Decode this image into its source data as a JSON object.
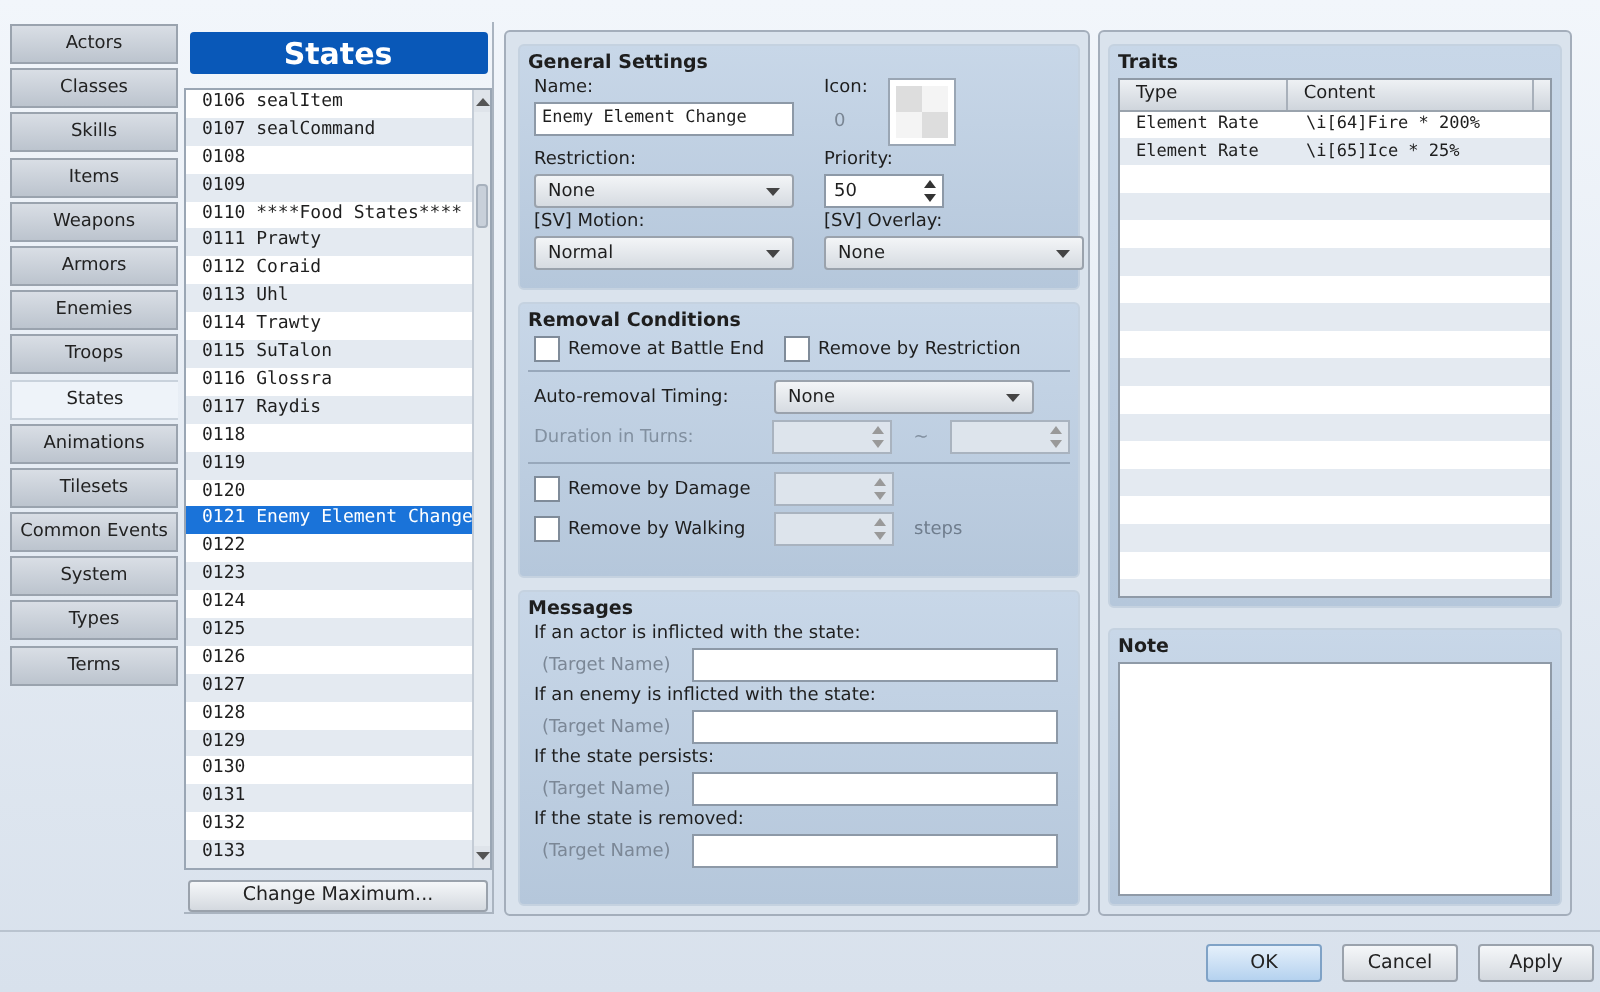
{
  "sidebar": {
    "items": [
      {
        "label": "Actors",
        "selected": false
      },
      {
        "label": "Classes",
        "selected": false
      },
      {
        "label": "Skills",
        "selected": false
      },
      {
        "label": "Items",
        "selected": false
      },
      {
        "label": "Weapons",
        "selected": false
      },
      {
        "label": "Armors",
        "selected": false
      },
      {
        "label": "Enemies",
        "selected": false
      },
      {
        "label": "Troops",
        "selected": false
      },
      {
        "label": "States",
        "selected": true
      },
      {
        "label": "Animations",
        "selected": false
      },
      {
        "label": "Tilesets",
        "selected": false
      },
      {
        "label": "Common Events",
        "selected": false
      },
      {
        "label": "System",
        "selected": false
      },
      {
        "label": "Types",
        "selected": false
      },
      {
        "label": "Terms",
        "selected": false
      }
    ]
  },
  "list": {
    "title": "States",
    "items": [
      {
        "label": "0106 sealItem",
        "selected": false
      },
      {
        "label": "0107 sealCommand",
        "selected": false
      },
      {
        "label": "0108",
        "selected": false
      },
      {
        "label": "0109",
        "selected": false
      },
      {
        "label": "0110 ****Food States****",
        "selected": false
      },
      {
        "label": "0111 Prawty",
        "selected": false
      },
      {
        "label": "0112 Coraid",
        "selected": false
      },
      {
        "label": "0113 Uhl",
        "selected": false
      },
      {
        "label": "0114 Trawty",
        "selected": false
      },
      {
        "label": "0115 SuTalon",
        "selected": false
      },
      {
        "label": "0116 Glossra",
        "selected": false
      },
      {
        "label": "0117 Raydis",
        "selected": false
      },
      {
        "label": "0118",
        "selected": false
      },
      {
        "label": "0119",
        "selected": false
      },
      {
        "label": "0120",
        "selected": false
      },
      {
        "label": "0121 Enemy Element Change",
        "selected": true
      },
      {
        "label": "0122",
        "selected": false
      },
      {
        "label": "0123",
        "selected": false
      },
      {
        "label": "0124",
        "selected": false
      },
      {
        "label": "0125",
        "selected": false
      },
      {
        "label": "0126",
        "selected": false
      },
      {
        "label": "0127",
        "selected": false
      },
      {
        "label": "0128",
        "selected": false
      },
      {
        "label": "0129",
        "selected": false
      },
      {
        "label": "0130",
        "selected": false
      },
      {
        "label": "0131",
        "selected": false
      },
      {
        "label": "0132",
        "selected": false
      },
      {
        "label": "0133",
        "selected": false
      }
    ],
    "button": "Change Maximum..."
  },
  "general": {
    "title": "General Settings",
    "name_label": "Name:",
    "name_value": "Enemy Element Change",
    "icon_label": "Icon:",
    "icon_index": "0",
    "restriction_label": "Restriction:",
    "restriction": "None",
    "priority_label": "Priority:",
    "priority": "50",
    "motion_label": "[SV] Motion:",
    "motion": "Normal",
    "overlay_label": "[SV] Overlay:",
    "overlay": "None"
  },
  "removal": {
    "title": "Removal Conditions",
    "checks": [
      {
        "label": "Remove at Battle End",
        "checked": false
      },
      {
        "label": "Remove by Restriction",
        "checked": false
      }
    ],
    "timing_label": "Auto-removal Timing:",
    "timing": "None",
    "duration": {
      "label": "Duration in Turns:",
      "separator": "~",
      "disabled": true
    },
    "damage": {
      "label": "Remove by Damage",
      "checked": false
    },
    "walking": {
      "label": "Remove by Walking",
      "checked": false,
      "unit": "steps"
    }
  },
  "messages": {
    "title": "Messages",
    "items": [
      {
        "label": "If an actor is inflicted with the state:",
        "prefix": "(Target Name)"
      },
      {
        "label": "If an enemy is inflicted with the state:",
        "prefix": "(Target Name)"
      },
      {
        "label": "If the state persists:",
        "prefix": "(Target Name)"
      },
      {
        "label": "If the state is removed:",
        "prefix": "(Target Name)"
      }
    ]
  },
  "traits": {
    "title": "Traits",
    "columns": [
      "Type",
      "Content"
    ],
    "rows": [
      {
        "type": "Element Rate",
        "content": "\\i[64]Fire * 200%"
      },
      {
        "type": "Element Rate",
        "content": "\\i[65]Ice * 25%"
      }
    ]
  },
  "note": {
    "title": "Note"
  },
  "buttons": [
    {
      "label": "OK",
      "default": true
    },
    {
      "label": "Cancel",
      "default": false
    },
    {
      "label": "Apply",
      "default": false
    }
  ]
}
